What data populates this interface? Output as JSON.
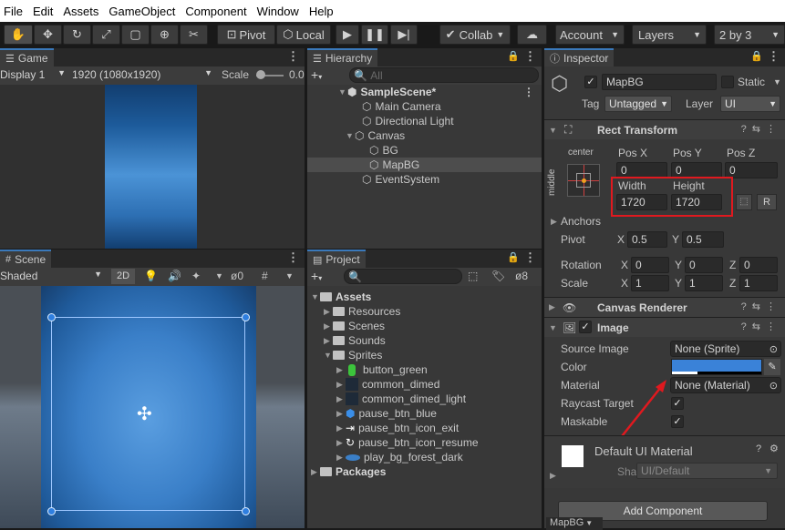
{
  "menu": [
    "File",
    "Edit",
    "Assets",
    "GameObject",
    "Component",
    "Window",
    "Help"
  ],
  "toolbar": {
    "pivot": "Pivot",
    "local": "Local",
    "collab": "Collab",
    "account": "Account",
    "layers": "Layers",
    "layout": "2 by 3"
  },
  "game": {
    "tab": "Game",
    "display": "Display 1",
    "resolution": "1920 (1080x1920)",
    "scale_label": "Scale",
    "scale_value": "0.0"
  },
  "scene": {
    "tab": "Scene",
    "shading": "Shaded",
    "mode2d": "2D",
    "gizmo_count": "0"
  },
  "hierarchy": {
    "tab": "Hierarchy",
    "search_placeholder": "All",
    "items": [
      {
        "label": "SampleScene*",
        "bold": true,
        "indent": 0,
        "arrow": "▼",
        "icon": "unity-scene-icon",
        "selected": false
      },
      {
        "label": "Main Camera",
        "indent": 2,
        "arrow": "",
        "icon": "gameobject-icon",
        "selected": false
      },
      {
        "label": "Directional Light",
        "indent": 2,
        "arrow": "",
        "icon": "gameobject-icon",
        "selected": false
      },
      {
        "label": "Canvas",
        "indent": 1,
        "arrow": "▼",
        "icon": "gameobject-icon",
        "selected": false
      },
      {
        "label": "BG",
        "indent": 3,
        "arrow": "",
        "icon": "gameobject-icon",
        "selected": false
      },
      {
        "label": "MapBG",
        "indent": 3,
        "arrow": "",
        "icon": "gameobject-icon",
        "selected": true
      },
      {
        "label": "EventSystem",
        "indent": 2,
        "arrow": "",
        "icon": "gameobject-icon",
        "selected": false
      }
    ]
  },
  "project": {
    "tab": "Project",
    "hidden_count": "8",
    "items": [
      {
        "label": "Assets",
        "bold": true,
        "indent": 0,
        "arrow": "▼",
        "icon": "folder-icon"
      },
      {
        "label": "Resources",
        "indent": 1,
        "arrow": "▶",
        "icon": "folder-icon"
      },
      {
        "label": "Scenes",
        "indent": 1,
        "arrow": "▶",
        "icon": "folder-icon"
      },
      {
        "label": "Sounds",
        "indent": 1,
        "arrow": "▶",
        "icon": "folder-icon"
      },
      {
        "label": "Sprites",
        "indent": 1,
        "arrow": "▼",
        "icon": "folder-icon"
      },
      {
        "label": "button_green",
        "indent": 2,
        "arrow": "▶",
        "icon": "sprite-green-icon"
      },
      {
        "label": "common_dimed",
        "indent": 2,
        "arrow": "▶",
        "icon": "sprite-dark-icon"
      },
      {
        "label": "common_dimed_light",
        "indent": 2,
        "arrow": "▶",
        "icon": "sprite-dark-icon"
      },
      {
        "label": "pause_btn_blue",
        "indent": 2,
        "arrow": "▶",
        "icon": "sprite-blue-icon"
      },
      {
        "label": "pause_btn_icon_exit",
        "indent": 2,
        "arrow": "▶",
        "icon": "sprite-exit-icon"
      },
      {
        "label": "pause_btn_icon_resume",
        "indent": 2,
        "arrow": "▶",
        "icon": "sprite-resume-icon"
      },
      {
        "label": "play_bg_forest_dark",
        "indent": 2,
        "arrow": "▶",
        "icon": "sprite-forest-icon"
      },
      {
        "label": "Packages",
        "bold": true,
        "indent": 0,
        "arrow": "▶",
        "icon": "folder-icon"
      }
    ]
  },
  "inspector": {
    "tab": "Inspector",
    "object_name": "MapBG",
    "static_label": "Static",
    "tag_label": "Tag",
    "tag_value": "Untagged",
    "layer_label": "Layer",
    "layer_value": "UI",
    "rect_transform": {
      "title": "Rect Transform",
      "anchor_preset_h": "center",
      "anchor_preset_v": "middle",
      "posx_label": "Pos X",
      "posy_label": "Pos Y",
      "posz_label": "Pos Z",
      "posx": "0",
      "posy": "0",
      "posz": "0",
      "width_label": "Width",
      "height_label": "Height",
      "width": "1720",
      "height": "1720",
      "anchors_label": "Anchors",
      "pivot_label": "Pivot",
      "pivot_x": "0.5",
      "pivot_y": "0.5",
      "rotation_label": "Rotation",
      "rot_x": "0",
      "rot_y": "0",
      "rot_z": "0",
      "scale_label": "Scale",
      "scale_x": "1",
      "scale_y": "1",
      "scale_z": "1",
      "x": "X",
      "y": "Y",
      "z": "Z",
      "r_button": "R"
    },
    "canvas_renderer": {
      "title": "Canvas Renderer"
    },
    "image": {
      "title": "Image",
      "source_label": "Source Image",
      "source_value": "None (Sprite)",
      "color_label": "Color",
      "color_value": "#3a82d8",
      "material_label": "Material",
      "material_value": "None (Material)",
      "raycast_label": "Raycast Target",
      "maskable_label": "Maskable"
    },
    "material_preview": {
      "name": "Default UI Material",
      "shader_label": "Shader",
      "shader_value": "UI/Default"
    },
    "add_component": "Add Component",
    "footer_label": "MapBG"
  },
  "colors": {
    "highlight": "#e0191f",
    "accent": "#3a79bb",
    "selection": "#2c5d87"
  }
}
